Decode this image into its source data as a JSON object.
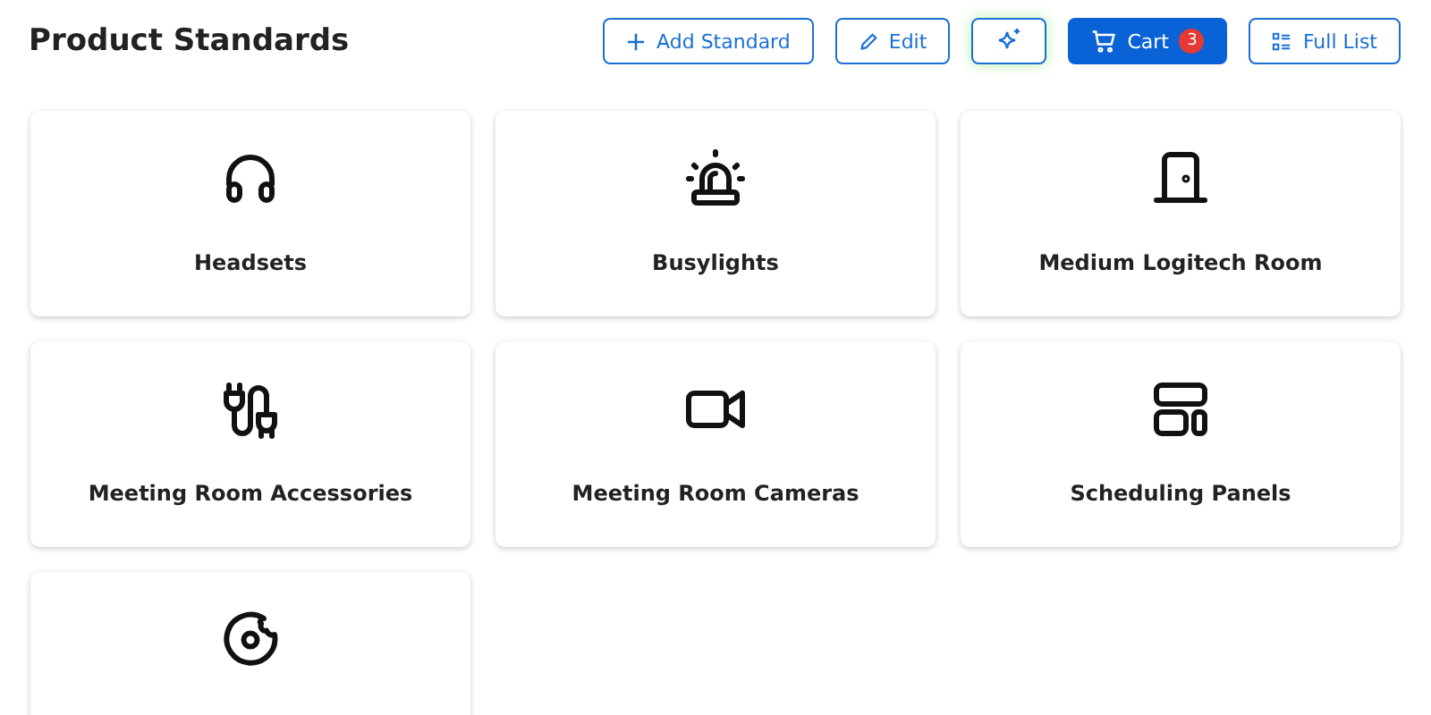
{
  "page": {
    "title": "Product Standards"
  },
  "toolbar": [
    {
      "kind": "add",
      "label": "Add Standard"
    },
    {
      "kind": "edit",
      "label": "Edit"
    },
    {
      "kind": "sparkle"
    },
    {
      "kind": "cart",
      "label": "Cart",
      "badge": "3"
    },
    {
      "kind": "list",
      "label": "Full List"
    }
  ],
  "cards": [
    {
      "kind": "headset",
      "label": "Headsets"
    },
    {
      "kind": "siren",
      "label": "Busylights"
    },
    {
      "kind": "door",
      "label": "Medium Logitech Room"
    },
    {
      "kind": "plug",
      "label": "Meeting Room Accessories"
    },
    {
      "kind": "camera",
      "label": "Meeting Room Cameras"
    },
    {
      "kind": "panels",
      "label": "Scheduling Panels"
    },
    {
      "kind": "donut"
    }
  ]
}
